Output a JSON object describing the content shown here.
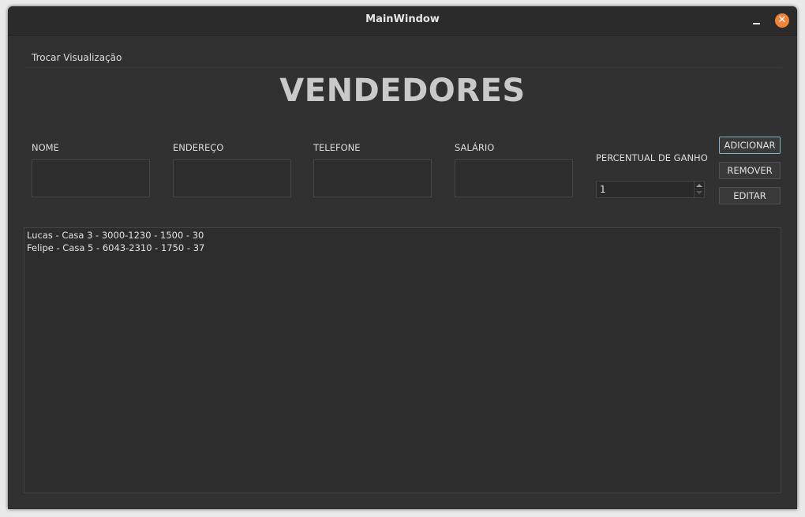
{
  "window": {
    "title": "MainWindow"
  },
  "menu": {
    "items": [
      "Trocar Visualização"
    ]
  },
  "heading": "VENDEDORES",
  "form": {
    "labels": {
      "nome": "NOME",
      "endereco": "ENDEREÇO",
      "telefone": "TELEFONE",
      "salario": "SALÁRIO",
      "percentual": "PERCENTUAL DE GANHO"
    },
    "values": {
      "nome": "",
      "endereco": "",
      "telefone": "",
      "salario": "",
      "percentual": "1"
    }
  },
  "buttons": {
    "adicionar": "ADICIONAR",
    "remover": "REMOVER",
    "editar": "EDITAR"
  },
  "list": {
    "items": [
      "Lucas - Casa 3 - 3000-1230 - 1500 - 30",
      "Felipe - Casa 5 - 6043-2310 - 1750 - 37"
    ]
  },
  "colors": {
    "accent_close": "#f08437",
    "focus_border": "#7fb0c9",
    "background": "#313131"
  }
}
